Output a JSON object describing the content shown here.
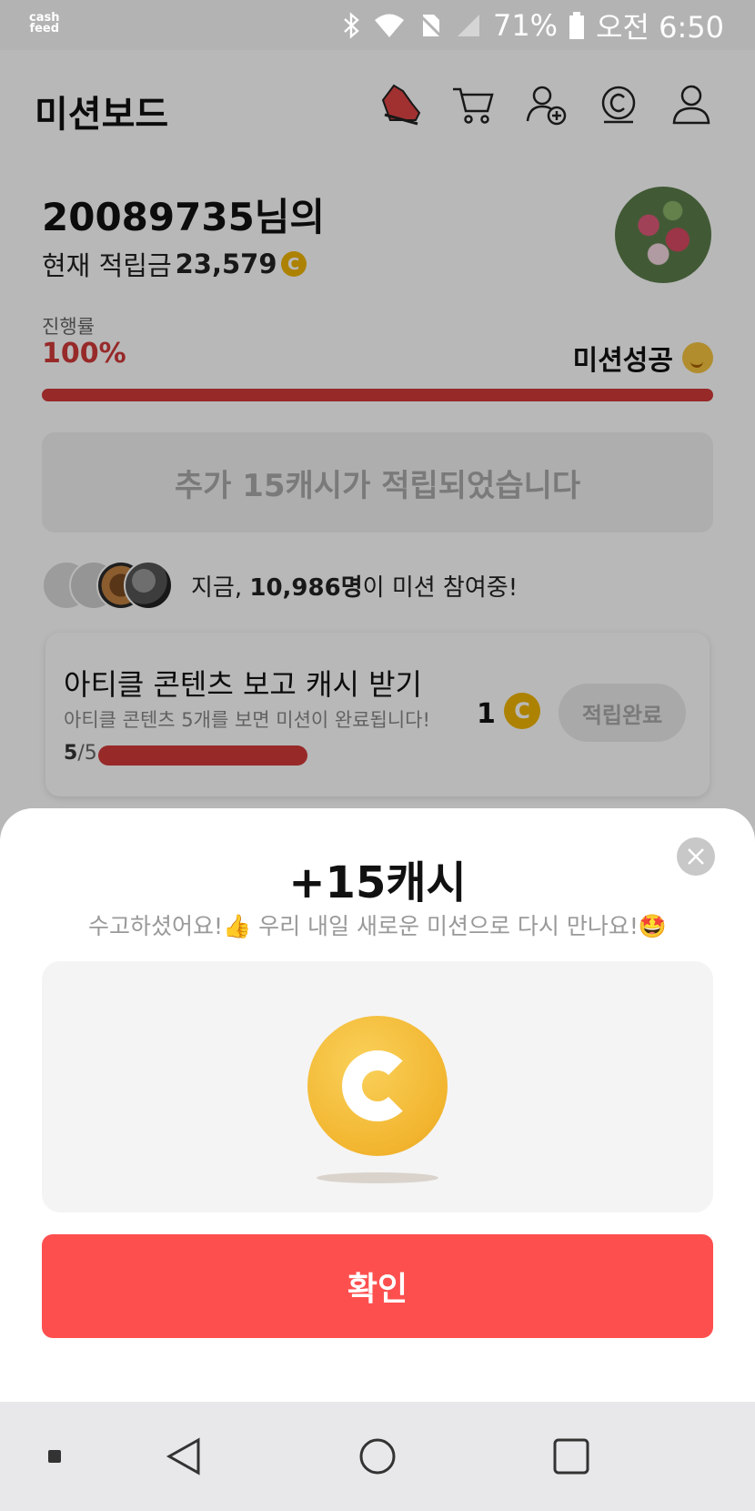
{
  "status_bar": {
    "logo_line1": "cash",
    "logo_line2": "feed",
    "battery": "71%",
    "time": "오전 6:50"
  },
  "header": {
    "title": "미션보드",
    "icons": [
      "shoe-icon",
      "cart-icon",
      "add-friend-icon",
      "cash-icon",
      "profile-icon"
    ]
  },
  "user": {
    "name": "20089735님의",
    "points_label": "현재 적립금",
    "points_value": "23,579",
    "coin_symbol": "C"
  },
  "progress": {
    "label": "진행률",
    "value_text": "100%",
    "value": 1.0,
    "status": "미션성공"
  },
  "bonus_message": "추가 15캐시가 적립되었습니다",
  "participants": {
    "prefix": "지금, ",
    "count": "10,986명",
    "suffix": "이 미션 참여중!"
  },
  "mission": {
    "title": "아티클 콘텐츠 보고 캐시 받기",
    "description": "아티클 콘텐츠 5개를 보면 미션이 완료됩니다!",
    "done": "5",
    "total": "/5",
    "reward": "1",
    "button_label": "적립완료"
  },
  "sheet": {
    "title": "+15캐시",
    "subtitle": "수고하셨어요!👍 우리 내일 새로운 미션으로 다시 만나요!🤩",
    "confirm_label": "확인"
  },
  "colors": {
    "accent_red": "#fe4f4f",
    "progress_red": "#d23a3a",
    "coin_gold": "#f2b52f"
  }
}
